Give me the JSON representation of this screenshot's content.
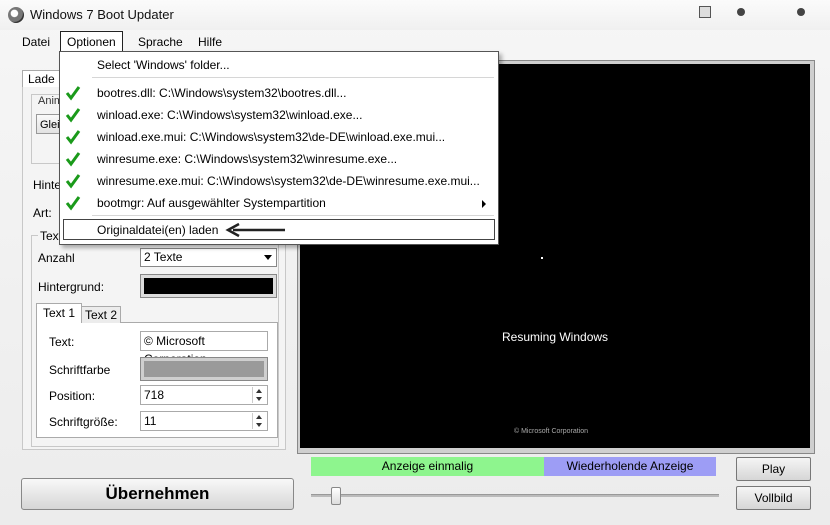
{
  "window": {
    "title": "Windows 7 Boot Updater"
  },
  "menubar": {
    "items": [
      "Datei",
      "Optionen",
      "Sprache",
      "Hilfe"
    ]
  },
  "optionen_menu": {
    "select_windows": "Select 'Windows' folder...",
    "files": [
      "bootres.dll: C:\\Windows\\system32\\bootres.dll...",
      "winload.exe: C:\\Windows\\system32\\winload.exe...",
      "winload.exe.mui: C:\\Windows\\system32\\de-DE\\winload.exe.mui...",
      "winresume.exe: C:\\Windows\\system32\\winresume.exe...",
      "winresume.exe.mui: C:\\Windows\\system32\\de-DE\\winresume.exe.mui..."
    ],
    "bootmgr": "bootmgr: Auf ausgewählter Systempartition",
    "original_laden": "Originaldatei(en) laden"
  },
  "left": {
    "tab_lade": "Lade",
    "anim_label": "Anim",
    "gleic_btn": "Gleic",
    "hinter_label": "Hinter",
    "art_label": "Art:",
    "text_group_label": "Text",
    "anzahl_label": "Anzahl",
    "anzahl_value": "2 Texte",
    "hintergrund_label": "Hintergrund:",
    "tab_text1": "Text 1",
    "tab_text2": "Text 2",
    "text_label": "Text:",
    "text_value": "© Microsoft Corporation",
    "schriftfarbe_label": "Schriftfarbe",
    "position_label": "Position:",
    "position_value": "718",
    "schriftgroesse_label": "Schriftgröße:",
    "schriftgroesse_value": "11"
  },
  "preview": {
    "resume_text": "Resuming Windows",
    "copyright": "© Microsoft Corporation"
  },
  "bottom": {
    "anzeige_einmalig": "Anzeige einmalig",
    "wiederholende_anzeige": "Wiederholende Anzeige",
    "play": "Play",
    "vollbild": "Vollbild",
    "ubernehmen": "Übernehmen",
    "slider_value": 0.05
  },
  "colors": {
    "green_bar": "#8ef58e",
    "blue_bar": "#9d9df5",
    "check": "#1a9a1a"
  }
}
